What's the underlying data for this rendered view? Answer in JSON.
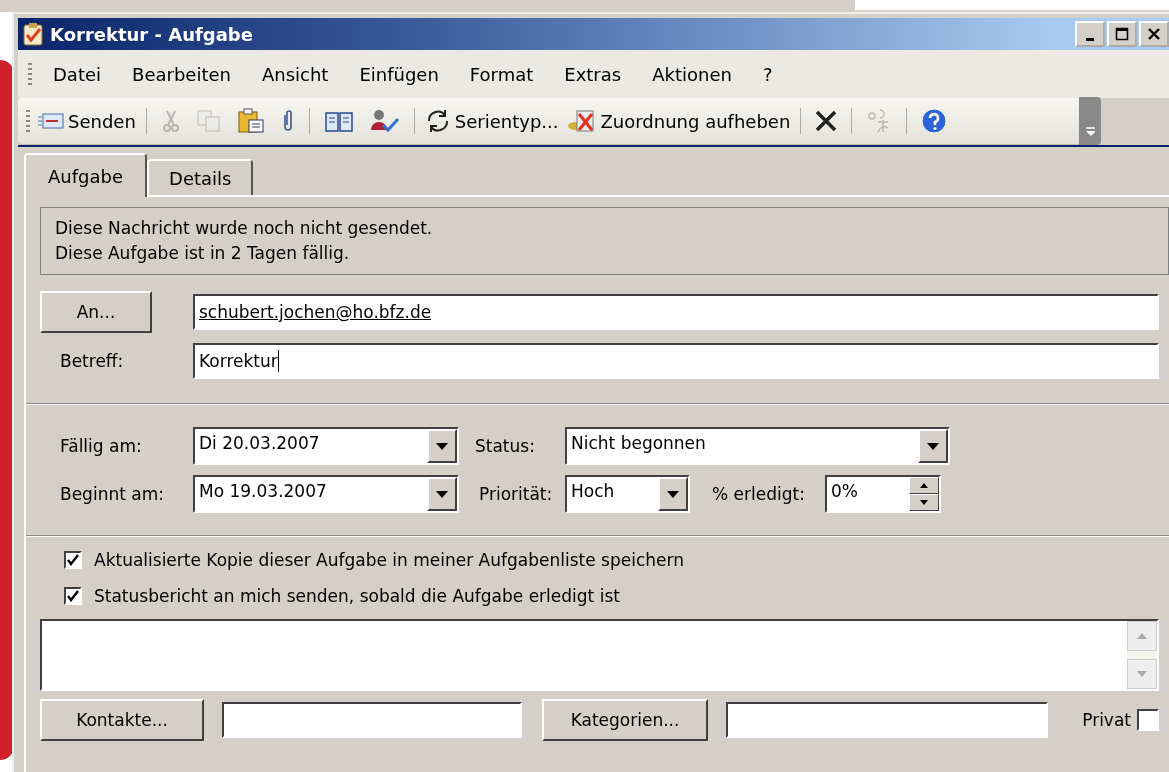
{
  "window": {
    "title": "Korrektur - Aufgabe"
  },
  "menu": [
    "Datei",
    "Bearbeiten",
    "Ansicht",
    "Einfügen",
    "Format",
    "Extras",
    "Aktionen",
    "?"
  ],
  "toolbar": {
    "send": "Senden",
    "cut_disabled": true,
    "copy_disabled": true,
    "recurrence": "Serientyp...",
    "unassign": "Zuordnung aufheben",
    "translate_disabled": true
  },
  "tabs": [
    {
      "label": "Aufgabe",
      "selected": true
    },
    {
      "label": "Details",
      "selected": false
    }
  ],
  "info": [
    "Diese Nachricht wurde noch nicht gesendet.",
    "Diese Aufgabe ist in 2 Tagen fällig."
  ],
  "to": {
    "button": "An...",
    "value": "schubert.jochen@ho.bfz.de"
  },
  "subject": {
    "label": "Betreff:",
    "value": "Korrektur"
  },
  "due": {
    "label": "Fällig am:",
    "value": "Di 20.03.2007"
  },
  "start": {
    "label": "Beginnt am:",
    "value": "Mo 19.03.2007"
  },
  "status": {
    "label": "Status:",
    "value": "Nicht begonnen"
  },
  "priority": {
    "label": "Priorität:",
    "value": "Hoch"
  },
  "percent": {
    "label": "% erledigt:",
    "value": "0%"
  },
  "options": [
    {
      "label": "Aktualisierte Kopie dieser Aufgabe in meiner Aufgabenliste speichern",
      "checked": true
    },
    {
      "label": "Statusbericht an mich senden, sobald die Aufgabe erledigt ist",
      "checked": true
    }
  ],
  "contacts_button": "Kontakte...",
  "categories_button": "Kategorien...",
  "private": {
    "label": "Privat",
    "checked": false
  }
}
